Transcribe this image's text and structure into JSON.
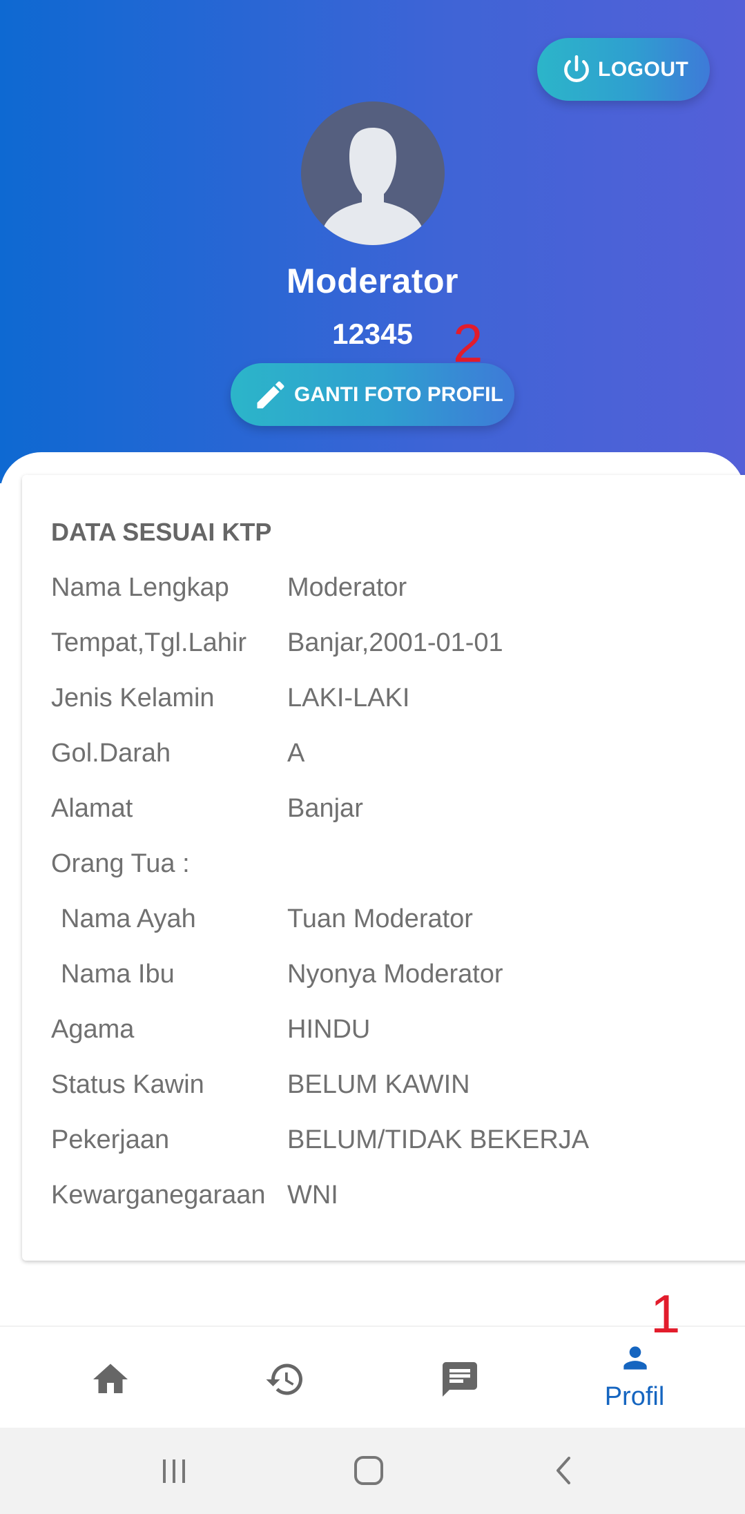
{
  "header": {
    "logout_label": "LOGOUT",
    "user_name": "Moderator",
    "user_id": "12345",
    "change_photo_label": "GANTI FOTO PROFIL",
    "background_colors": [
      "#0e69d2",
      "#5460d8"
    ]
  },
  "annotations": {
    "marker_1": "1",
    "marker_2": "2",
    "color": "#e21c2c"
  },
  "ktp": {
    "title": "DATA SESUAI KTP",
    "rows": [
      {
        "label": "Nama Lengkap",
        "value": "Moderator"
      },
      {
        "label": "Tempat,Tgl.Lahir",
        "value": "Banjar,2001-01-01"
      },
      {
        "label": "Jenis Kelamin",
        "value": "LAKI-LAKI"
      },
      {
        "label": "Gol.Darah",
        "value": "A"
      },
      {
        "label": "Alamat",
        "value": "Banjar"
      },
      {
        "label": "Orang Tua :",
        "value": ""
      },
      {
        "label": "Nama Ayah",
        "value": "Tuan Moderator"
      },
      {
        "label": "Nama Ibu",
        "value": "Nyonya Moderator"
      },
      {
        "label": "Agama",
        "value": "HINDU"
      },
      {
        "label": "Status Kawin",
        "value": "BELUM KAWIN"
      },
      {
        "label": "Pekerjaan",
        "value": "BELUM/TIDAK BEKERJA"
      },
      {
        "label": "Kewarganegaraan",
        "value": "WNI"
      }
    ]
  },
  "bottom_nav": {
    "items": [
      {
        "icon": "home-icon",
        "label": ""
      },
      {
        "icon": "history-icon",
        "label": ""
      },
      {
        "icon": "chat-icon",
        "label": ""
      },
      {
        "icon": "person-icon",
        "label": "Profil",
        "active": true
      }
    ],
    "active_color": "#1565c0",
    "inactive_color": "#666666"
  },
  "system_nav": {
    "icons": [
      "recent-apps-icon",
      "home-button-icon",
      "back-icon"
    ]
  }
}
